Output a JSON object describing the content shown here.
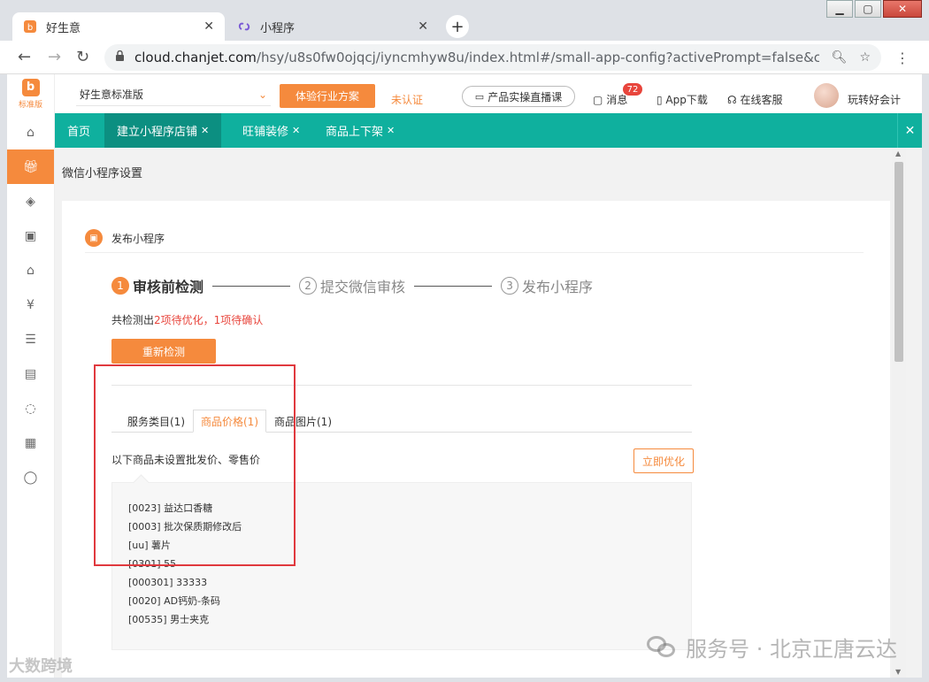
{
  "browser": {
    "tabs": [
      {
        "title": "好生意",
        "active": true
      },
      {
        "title": "小程序",
        "active": false
      }
    ],
    "url_host": "cloud.chanjet.com",
    "url_path": "/hsy/u8s0fw0ojqcj/iyncmhyw8u/index.html#/small-app-config?activePrompt=false&closeProm..."
  },
  "sidebar": {
    "logo_label": "标准版",
    "items": [
      "home-icon",
      "gift-icon",
      "store-icon",
      "bag-icon",
      "warehouse-icon",
      "money-icon",
      "clipboard-icon",
      "card-icon",
      "cycle-icon",
      "new-icon",
      "chat-icon"
    ]
  },
  "topbar": {
    "edition": "好生意标准版",
    "experience_btn": "体验行业方案",
    "unverified": "未认证",
    "live_btn": "产品实操直播课",
    "messages": "消息",
    "message_badge": "72",
    "app_download": "App下载",
    "online_service": "在线客服",
    "username": "玩转好会计"
  },
  "tabnav": {
    "home": "首页",
    "tabs": [
      "建立小程序店铺",
      "旺铺装修",
      "商品上下架"
    ]
  },
  "page": {
    "title": "微信小程序设置",
    "section_title": "发布小程序",
    "steps": [
      {
        "num": "1",
        "label": "审核前检测"
      },
      {
        "num": "2",
        "label": "提交微信审核"
      },
      {
        "num": "3",
        "label": "发布小程序"
      }
    ],
    "summary_prefix": "共检测出",
    "summary_highlight": "2项待优化，1项待确认",
    "recheck_btn": "重新检测",
    "subtabs": [
      "服务类目(1)",
      "商品价格(1)",
      "商品图片(1)"
    ],
    "description": "以下商品未设置批发价、零售价",
    "optimize_btn": "立即优化",
    "products": [
      "[0023] 益达口香糖",
      "[0003] 批次保质期修改后",
      "[uu] 薯片",
      "[0301] 55",
      "[000301] 33333",
      "[0020] AD钙奶-条码",
      "[00535] 男士夹克"
    ]
  },
  "watermark": {
    "text": "服务号 · 北京正唐云达",
    "corner": "大数跨境"
  },
  "colors": {
    "accent": "#f58a3d",
    "teal": "#0fb09e",
    "highlight_red": "#e8453c"
  }
}
